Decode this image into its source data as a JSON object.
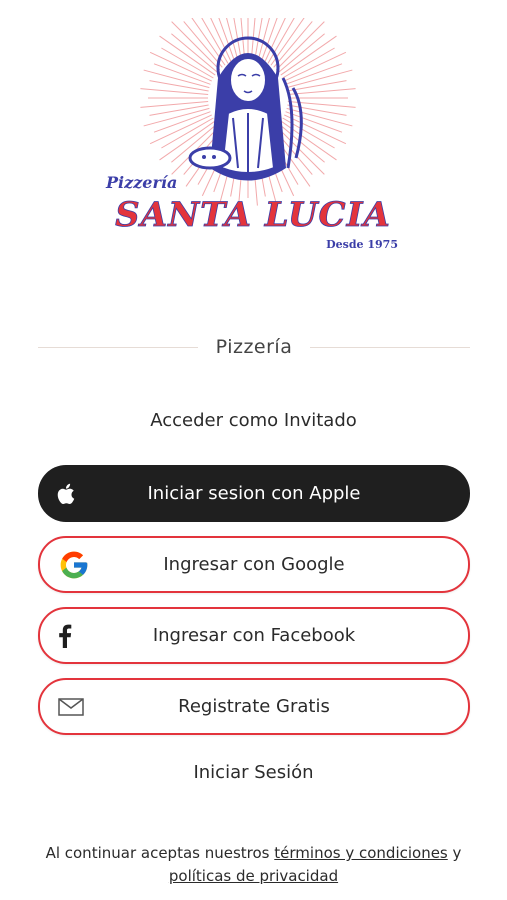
{
  "logo": {
    "script_word": "Pizzería",
    "brand_name": "SANTA LUCIA",
    "since": "Desde 1975",
    "colors": {
      "red": "#e3343c",
      "blue": "#3b3ea8",
      "rays": "#f2a9ab"
    }
  },
  "section_label": "Pizzería",
  "guest_link": "Acceder como Invitado",
  "buttons": {
    "apple": {
      "label": "Iniciar sesion con Apple",
      "icon": "apple-icon"
    },
    "google": {
      "label": "Ingresar con Google",
      "icon": "google-icon"
    },
    "facebook": {
      "label": "Ingresar con Facebook",
      "icon": "facebook-icon"
    },
    "register": {
      "label": "Registrate Gratis",
      "icon": "envelope-icon"
    }
  },
  "login_link": "Iniciar Sesión",
  "legal": {
    "prefix": "Al continuar aceptas nuestros",
    "terms_link": "términos y condiciones",
    "conjunction": "y",
    "privacy_link": "políticas de privacidad"
  },
  "colors": {
    "accent": "#e3343c",
    "dark_button": "#1f1f1f",
    "text": "#2b2b2b"
  }
}
